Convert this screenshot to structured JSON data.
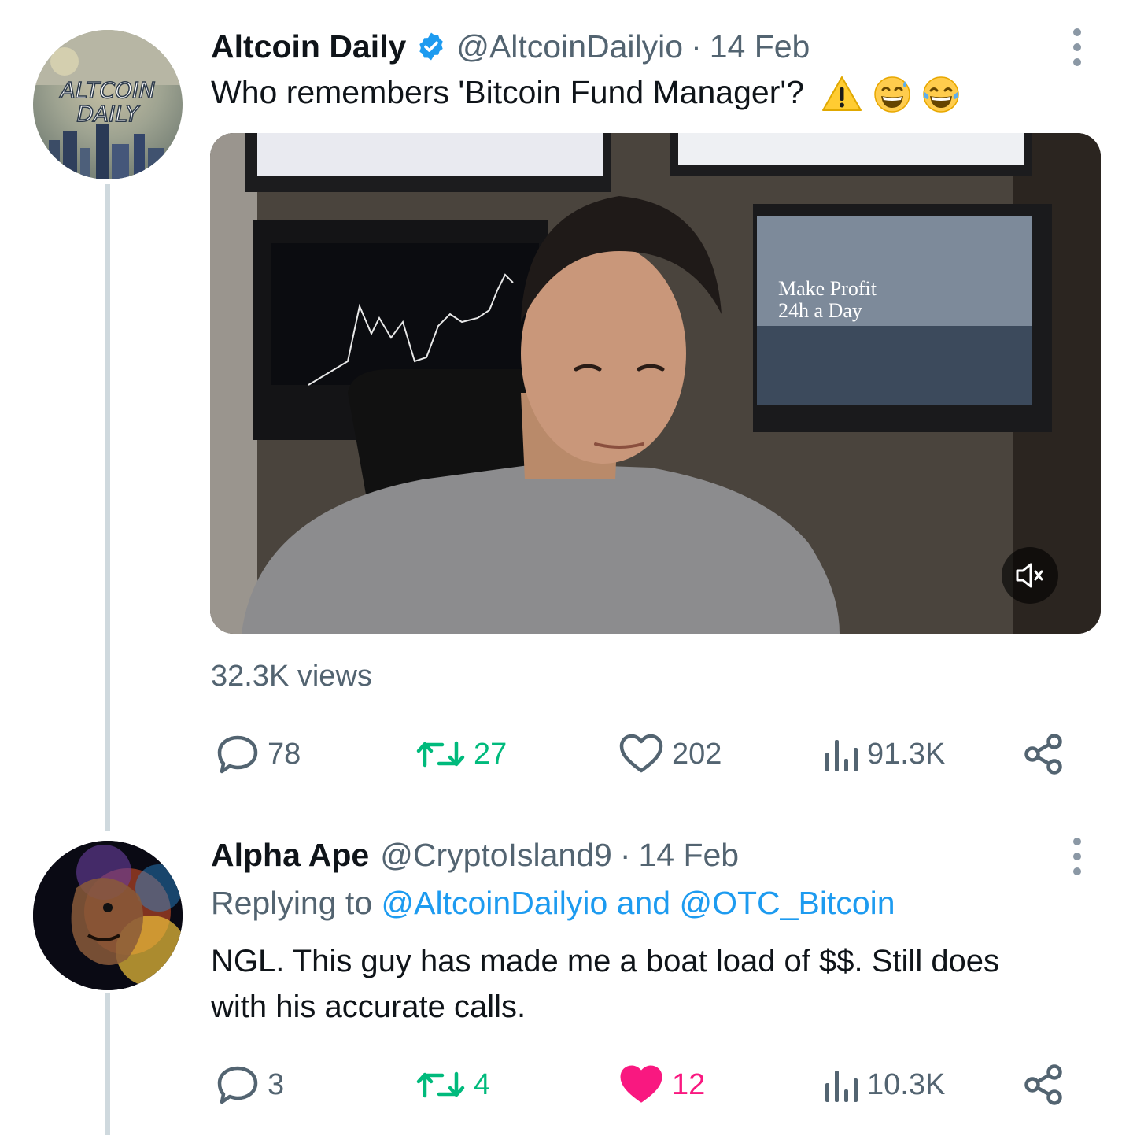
{
  "colors": {
    "accent": "#1d9bf0",
    "retweet": "#00ba7c",
    "like": "#f91880",
    "muted": "#536471",
    "text": "#0f1419"
  },
  "tweet1": {
    "avatar_text_line1": "ALTCOIN",
    "avatar_text_line2": "DAILY",
    "name": "Altcoin Daily",
    "handle": "@AltcoinDailyio",
    "separator": "·",
    "date": "14 Feb",
    "text": "Who remembers 'Bitcoin Fund Manager'?",
    "emojis": [
      "warning-emoji",
      "grinning-sweat-emoji",
      "tears-of-joy-emoji"
    ],
    "video": {
      "screen_text_line1": "Make Profit",
      "screen_text_line2": "24h a Day",
      "muted": true
    },
    "views_label": "32.3K views",
    "stats": {
      "replies": "78",
      "retweets": "27",
      "likes": "202",
      "views": "91.3K"
    }
  },
  "tweet2": {
    "name": "Alpha Ape",
    "handle": "@CryptoIsland9",
    "separator": "·",
    "date": "14 Feb",
    "replying_prefix": "Replying to",
    "replying_to_1": "@AltcoinDailyio",
    "replying_and": "and",
    "replying_to_2": "@OTC_Bitcoin",
    "text_line1": "NGL. This guy has made me a boat load of $$. Still does",
    "text_line2": "with his accurate calls.",
    "stats": {
      "replies": "3",
      "retweets": "4",
      "likes": "12",
      "views": "10.3K",
      "liked": true
    }
  }
}
